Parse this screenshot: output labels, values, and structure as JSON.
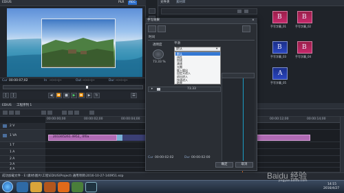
{
  "player": {
    "title": "EDIUS",
    "badge_left": "PLR",
    "badge_right": "REC",
    "timecode_cur_label": "Cur",
    "timecode_cur": "00:00:07;02",
    "timecode_in_label": "In",
    "timecode_in": "--:--:--;--",
    "timecode_out_label": "Out",
    "timecode_out": "--:--:--;--",
    "timecode_dur_label": "Dur",
    "timecode_dur": "--:--:--;--"
  },
  "bin": {
    "title": "文件夹",
    "badge": "素材库",
    "items": [
      {
        "label": "手写字幕_01"
      },
      {
        "label": "手写字幕_02"
      },
      {
        "label": "手写字幕_03"
      },
      {
        "label": "手写字幕_04"
      },
      {
        "label": "手写字幕_05"
      }
    ]
  },
  "dialog": {
    "title": "手写效果",
    "section_label": "时间",
    "smooth_label": "平滑",
    "transparency_label": "透明度",
    "transparency_value": "73.33 %",
    "options": [
      "默认",
      "线性",
      "加速",
      "减速",
      "光圈",
      "缓入缓出",
      "自定义进入",
      "退出进入",
      "快速进入",
      "结束"
    ],
    "selected_index": 0,
    "track_value": "73.33",
    "cur_label": "Cur",
    "cur_value": "00:00:02:02",
    "dur_label": "Dur",
    "dur_value": "00:00:02:00",
    "ok_label": "确定",
    "cancel_label": "取消"
  },
  "timeline": {
    "title": "EDIUS",
    "project": "工程序列 1",
    "ruler_ticks": [
      "00:00:00;00",
      "00:00:02;00",
      "00:00:04;00",
      "00:00:06;00",
      "00:00:08;00",
      "00:00:10;00",
      "00:00:12;00",
      "00:00:14;00"
    ],
    "tracks": [
      {
        "name": "2 V",
        "type": "video"
      },
      {
        "name": "1 VA",
        "type": "videoaudio"
      },
      {
        "name": "1 T",
        "type": "title"
      },
      {
        "name": "1 A",
        "type": "audio"
      },
      {
        "name": "2 A",
        "type": "audio"
      },
      {
        "name": "3 A",
        "type": "audio"
      },
      {
        "name": "4 A",
        "type": "audio"
      }
    ],
    "clip_label": "201305261 4952_ 0f0a"
  },
  "status": {
    "text": "成功加载文件 - E:\\素材\\图片\\工程\\EDIUS\\Project\\ 通用项目\\2016-10-27-140951.ezp"
  },
  "taskbar": {
    "watermark": "Baidu 经验",
    "watermark_url": "jingyan.baidu.com",
    "time": "14:15",
    "date": "2016/4/27"
  }
}
